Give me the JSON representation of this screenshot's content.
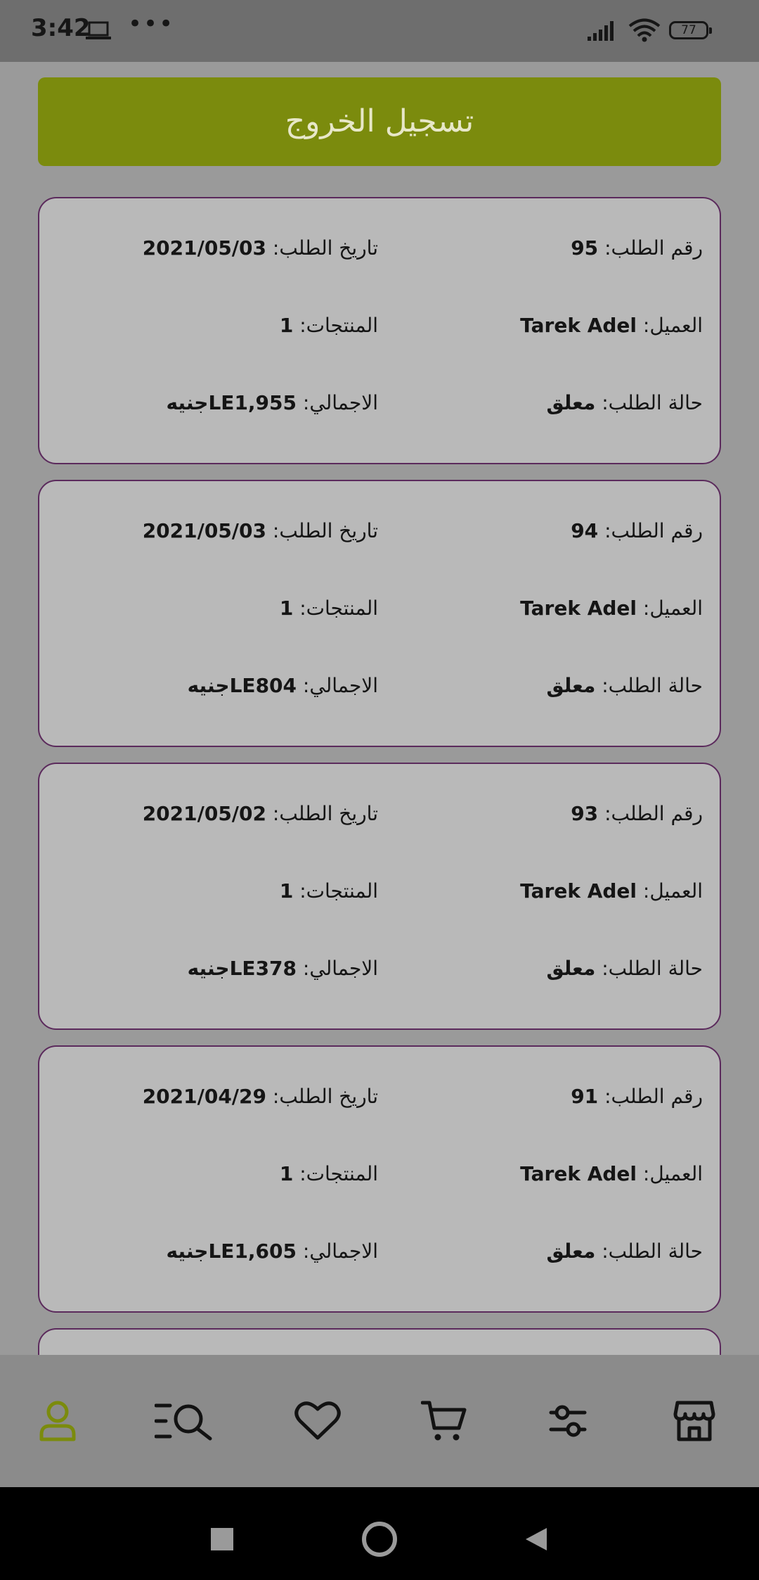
{
  "status_bar": {
    "time": "3:42",
    "dots": "•••",
    "battery": "77"
  },
  "logout_label": "تسجيل الخروج",
  "orders": [
    {
      "number_label": "رقم الطلب:",
      "number": "95",
      "date_label": "تاريخ الطلب:",
      "date": "2021/05/03",
      "customer_label": "العميل:",
      "customer": "Tarek Adel",
      "products_label": "المنتجات:",
      "products": "1",
      "status_label": "حالة الطلب:",
      "status": "معلق",
      "total_label": "الاجمالي:",
      "total": "LE1,955جنيه"
    },
    {
      "number_label": "رقم الطلب:",
      "number": "94",
      "date_label": "تاريخ الطلب:",
      "date": "2021/05/03",
      "customer_label": "العميل:",
      "customer": "Tarek Adel",
      "products_label": "المنتجات:",
      "products": "1",
      "status_label": "حالة الطلب:",
      "status": "معلق",
      "total_label": "الاجمالي:",
      "total": "LE804جنيه"
    },
    {
      "number_label": "رقم الطلب:",
      "number": "93",
      "date_label": "تاريخ الطلب:",
      "date": "2021/05/02",
      "customer_label": "العميل:",
      "customer": "Tarek Adel",
      "products_label": "المنتجات:",
      "products": "1",
      "status_label": "حالة الطلب:",
      "status": "معلق",
      "total_label": "الاجمالي:",
      "total": "LE378جنيه"
    },
    {
      "number_label": "رقم الطلب:",
      "number": "91",
      "date_label": "تاريخ الطلب:",
      "date": "2021/04/29",
      "customer_label": "العميل:",
      "customer": "Tarek Adel",
      "products_label": "المنتجات:",
      "products": "1",
      "status_label": "حالة الطلب:",
      "status": "معلق",
      "total_label": "الاجمالي:",
      "total": "LE1,605جنيه"
    }
  ],
  "bottom_nav": [
    {
      "icon": "user-icon",
      "active": true
    },
    {
      "icon": "search-list-icon",
      "active": false
    },
    {
      "icon": "heart-icon",
      "active": false
    },
    {
      "icon": "cart-icon",
      "active": false
    },
    {
      "icon": "filter-sliders-icon",
      "active": false
    },
    {
      "icon": "store-icon",
      "active": false
    }
  ],
  "colors": {
    "accent": "#7b8b0d",
    "active_icon": "#7b8b0d",
    "card_border": "#5b2a5c",
    "card_background": "#b9b9b9",
    "page_background": "#9a9a9a"
  },
  "system_nav": [
    "recents-button",
    "home-button",
    "back-button"
  ]
}
